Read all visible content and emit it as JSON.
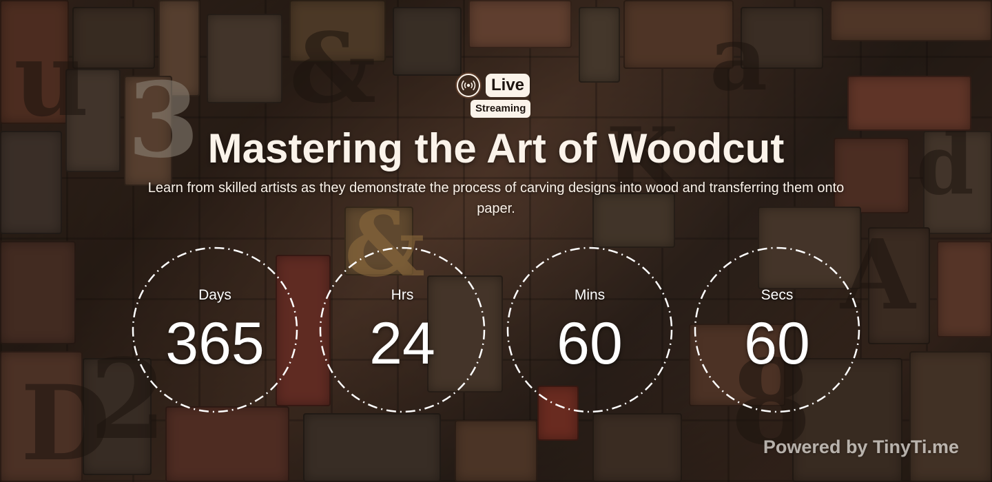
{
  "badge": {
    "icon": "broadcast-icon",
    "live_label": "Live",
    "streaming_label": "Streaming"
  },
  "event": {
    "title": "Mastering the Art of Woodcut",
    "description": "Learn from skilled artists as they demonstrate the process of carving designs into wood and transferring them onto paper."
  },
  "countdown": {
    "days": {
      "label": "Days",
      "value": "365"
    },
    "hours": {
      "label": "Hrs",
      "value": "24"
    },
    "minutes": {
      "label": "Mins",
      "value": "60"
    },
    "seconds": {
      "label": "Secs",
      "value": "60"
    }
  },
  "footer": {
    "powered_by": "Powered by TinyTi.me"
  },
  "colors": {
    "text": "#fbf3ea",
    "badge_dark": "#3d2a1e",
    "ring": "#ffffff"
  }
}
